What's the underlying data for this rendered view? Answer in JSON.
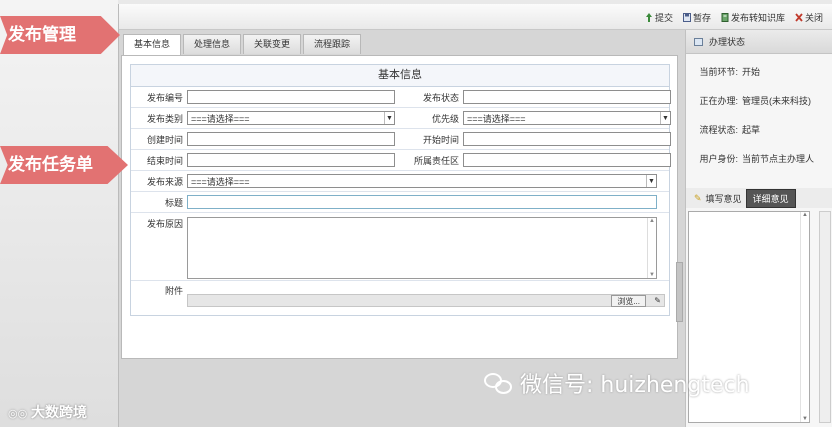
{
  "overlay": {
    "tag_top": "发布管理",
    "tag_middle": "发布任务单",
    "brand_watermark": "大数跨境",
    "wechat_watermark": "微信号: huizhengtech"
  },
  "toolbar": {
    "buttons": [
      {
        "label": "提交",
        "icon": "submit-icon",
        "color": "#3a8a3a"
      },
      {
        "label": "暂存",
        "icon": "save-icon",
        "color": "#4b5d8a"
      },
      {
        "label": "发布转知识库",
        "icon": "knowledge-icon",
        "color": "#3a7a3a"
      },
      {
        "label": "关闭",
        "icon": "close-icon",
        "color": "#c0392b"
      }
    ]
  },
  "tabs": [
    "基本信息",
    "处理信息",
    "关联变更",
    "流程跟踪"
  ],
  "form": {
    "title": "基本信息",
    "labels": {
      "release_no": "发布编号",
      "release_status": "发布状态",
      "release_category": "发布类别",
      "priority": "优先级",
      "created_time": "创建时间",
      "start_time": "开始时间",
      "end_time": "结束时间",
      "responsible_area": "所属责任区",
      "release_source": "发布来源",
      "title": "标题",
      "reason": "发布原因",
      "attachment": "附件"
    },
    "select_placeholder": "===请选择===",
    "browse_label": "浏览..."
  },
  "side": {
    "header": "办理状态",
    "rows": [
      {
        "key": "当前环节:",
        "value": "开始"
      },
      {
        "key": "正在办理:",
        "value": "管理员(未来科技)"
      },
      {
        "key": "流程状态:",
        "value": "起草"
      },
      {
        "key": "用户身份:",
        "value": "当前节点主办理人"
      }
    ],
    "opinion_label": "填写意见",
    "opinion_button": "详细意见"
  }
}
